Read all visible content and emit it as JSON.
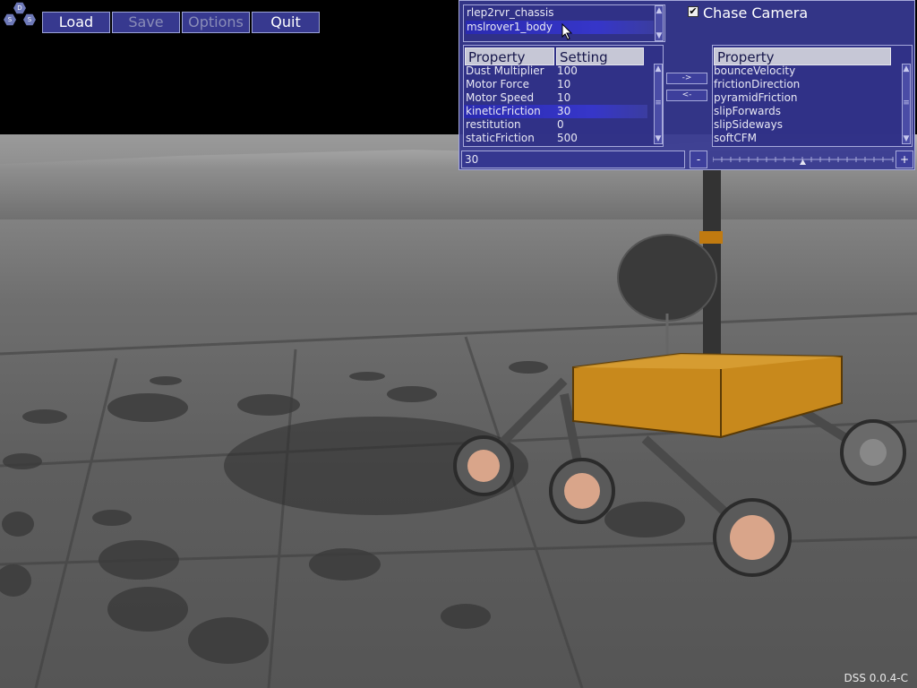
{
  "toolbar": {
    "load": "Load",
    "save": "Save",
    "options": "Options",
    "quit": "Quit"
  },
  "logo": {
    "letters": [
      "D",
      "S",
      "S"
    ]
  },
  "object_list": {
    "items": [
      "rlep2rvr_chassis",
      "mslrover1_body"
    ],
    "selected": "mslrover1_body"
  },
  "chase_camera": {
    "label": "Chase Camera",
    "checked": true,
    "check_glyph": "✔"
  },
  "left_table": {
    "headers": [
      "Property",
      "Setting"
    ],
    "rows": [
      [
        "Dust Multiplier",
        "100"
      ],
      [
        "Motor Force",
        "10"
      ],
      [
        "Motor Speed",
        "10"
      ],
      [
        "kineticFriction",
        "30"
      ],
      [
        "restitution",
        "0"
      ],
      [
        "staticFriction",
        "500"
      ]
    ],
    "selected": "kineticFriction"
  },
  "transfer": {
    "add": "->",
    "remove": "<-"
  },
  "right_table": {
    "header": "Property",
    "rows": [
      "bounceVelocity",
      "frictionDirection",
      "pyramidFriction",
      "slipForwards",
      "slipSideways",
      "softCFM"
    ]
  },
  "value_field": "30",
  "decrement": "-",
  "increment": "+",
  "version": "DSS 0.0.4-C",
  "colors": {
    "panel": "#37398f",
    "panel_border": "#a6a9da",
    "selection": "#2f2fc0",
    "header": "#c6c7d6",
    "rover_gold": "#c8891c"
  },
  "icons": [
    "check-icon",
    "scroll-up-icon",
    "scroll-down-icon",
    "slider-thumb-icon",
    "mouse-cursor-icon"
  ]
}
